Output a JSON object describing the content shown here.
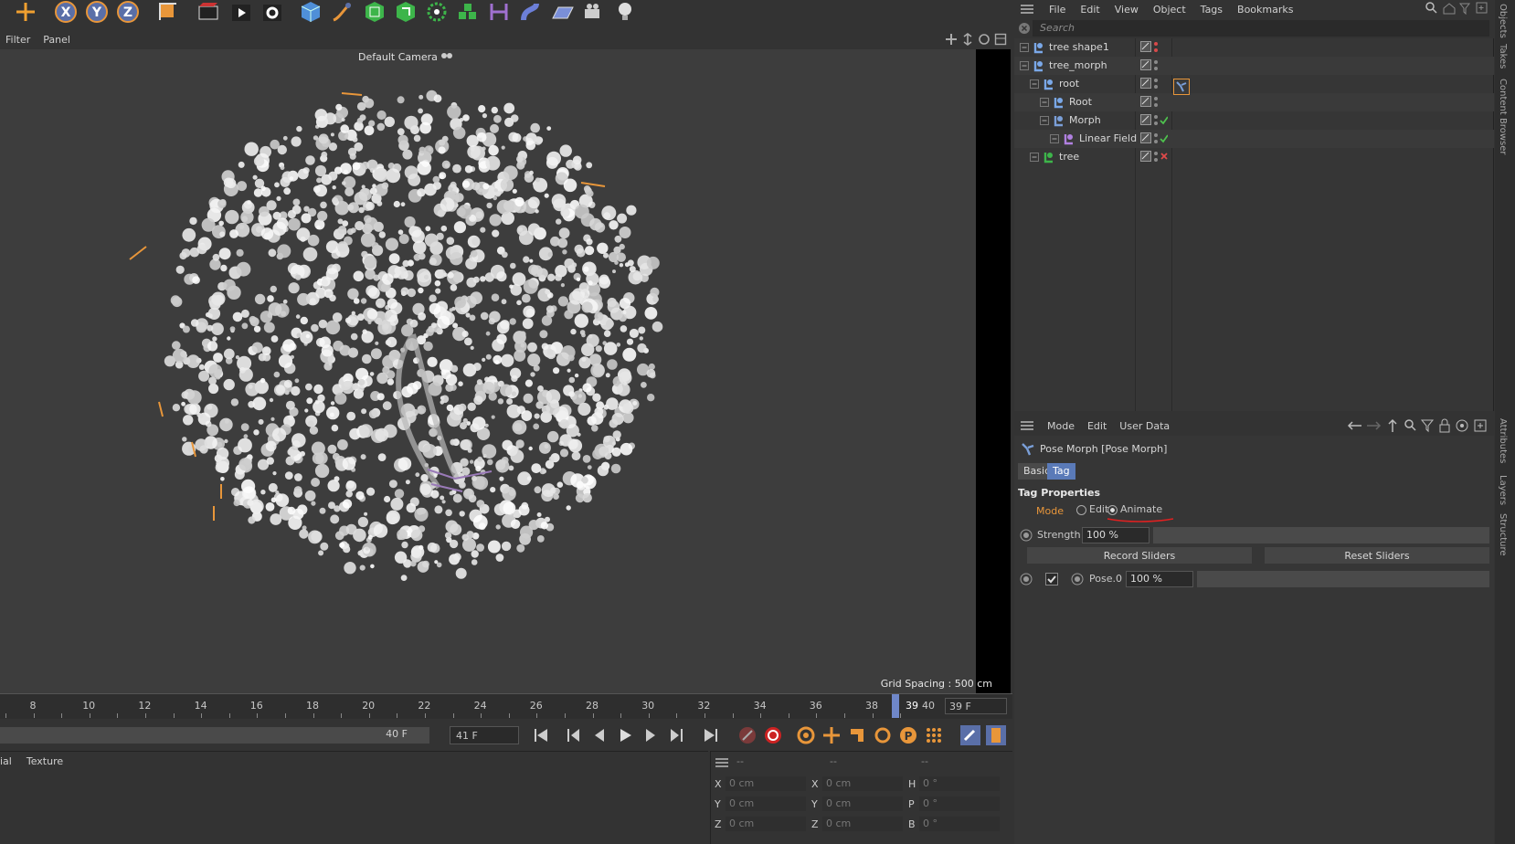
{
  "toolbar": {
    "tools": [
      "move-icon",
      "x-axis-icon",
      "y-axis-icon",
      "z-axis-icon",
      "coordinate-system-icon",
      "render-view-icon",
      "render-picture-queue-icon",
      "render-settings-icon",
      "cube-icon",
      "pen-icon",
      "subdivision-icon",
      "extrude-icon",
      "cloner-icon",
      "generator-icon",
      "field-icon",
      "deformer-icon",
      "floor-icon",
      "camera-icon",
      "light-icon"
    ]
  },
  "viewport": {
    "menu": [
      "Filter",
      "Panel"
    ],
    "camera_label": "Default Camera",
    "grid_spacing": "Grid Spacing : 500 cm"
  },
  "timeline": {
    "ticks": [
      "8",
      "10",
      "12",
      "14",
      "16",
      "18",
      "20",
      "22",
      "24",
      "26",
      "28",
      "30",
      "32",
      "34",
      "36",
      "38",
      "39",
      "40"
    ],
    "current_frame_field": "39 F",
    "range_end": "40 F",
    "frame_input": "41 F"
  },
  "material_panel": {
    "menu": [
      "ial",
      "Texture"
    ]
  },
  "coordinates": {
    "header": [
      "--",
      "--",
      "--"
    ],
    "rows": [
      {
        "a": "X",
        "av": "0 cm",
        "b": "X",
        "bv": "0 cm",
        "c": "H",
        "cv": "0 °"
      },
      {
        "a": "Y",
        "av": "0 cm",
        "b": "Y",
        "bv": "0 cm",
        "c": "P",
        "cv": "0 °"
      },
      {
        "a": "Z",
        "av": "0 cm",
        "b": "Z",
        "bv": "0 cm",
        "c": "B",
        "cv": "0 °"
      }
    ]
  },
  "object_manager": {
    "menu": [
      "File",
      "Edit",
      "View",
      "Object",
      "Tags",
      "Bookmarks"
    ],
    "search_placeholder": "Search",
    "objects": [
      {
        "name": "tree shape1",
        "indent": 0,
        "status": "red"
      },
      {
        "name": "tree_morph",
        "indent": 0,
        "status": "gray"
      },
      {
        "name": "root",
        "indent": 1,
        "status": "gray"
      },
      {
        "name": "Root",
        "indent": 2,
        "status": "gray"
      },
      {
        "name": "Morph",
        "indent": 2,
        "status": "check"
      },
      {
        "name": "Linear Field",
        "indent": 3,
        "status": "check"
      },
      {
        "name": "tree",
        "indent": 1,
        "status": "cross"
      }
    ]
  },
  "attributes": {
    "menu": [
      "Mode",
      "Edit",
      "User Data"
    ],
    "title": "Pose Morph [Pose Morph]",
    "tabs": [
      "Basic",
      "Tag"
    ],
    "section": "Tag Properties",
    "mode_label": "Mode",
    "mode_options": [
      "Edit",
      "Animate"
    ],
    "strength_label": "Strength",
    "strength_value": "100 %",
    "record_button": "Record Sliders",
    "reset_button": "Reset Sliders",
    "pose_label": "Pose.0",
    "pose_value": "100 %"
  },
  "side_tabs": {
    "top": [
      "Objects",
      "Takes",
      "Content Browser"
    ],
    "bottom": [
      "Attributes",
      "Layers",
      "Structure"
    ]
  },
  "colors": {
    "accent": "#5a7ab8",
    "orange": "#e8963a",
    "background": "#333333"
  }
}
